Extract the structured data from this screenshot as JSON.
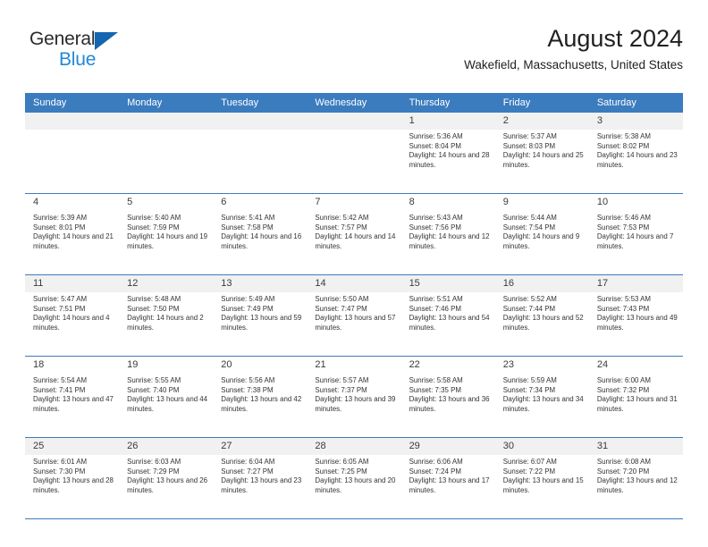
{
  "brand": {
    "line1": "General",
    "line2": "Blue",
    "mark": "triangle-icon",
    "color_dark": "#2b2b2b",
    "color_blue": "#2089d8",
    "mark_color": "#1565b0"
  },
  "header": {
    "title": "August 2024",
    "subtitle": "Wakefield, Massachusetts, United States"
  },
  "theme": {
    "header_bg": "#3b7cbe",
    "header_text": "#ffffff",
    "row_shade": "#f1f1f1",
    "grid_line": "#3b7cbe"
  },
  "labels": {
    "sunrise": "Sunrise:",
    "sunset": "Sunset:",
    "daylight": "Daylight:"
  },
  "weekday_headers": [
    "Sunday",
    "Monday",
    "Tuesday",
    "Wednesday",
    "Thursday",
    "Friday",
    "Saturday"
  ],
  "weeks": [
    [
      {
        "day": "",
        "lines": []
      },
      {
        "day": "",
        "lines": []
      },
      {
        "day": "",
        "lines": []
      },
      {
        "day": "",
        "lines": []
      },
      {
        "day": "1",
        "lines": [
          "Sunrise: 5:36 AM",
          "Sunset: 8:04 PM",
          "Daylight: 14 hours and 28 minutes."
        ]
      },
      {
        "day": "2",
        "lines": [
          "Sunrise: 5:37 AM",
          "Sunset: 8:03 PM",
          "Daylight: 14 hours and 25 minutes."
        ]
      },
      {
        "day": "3",
        "lines": [
          "Sunrise: 5:38 AM",
          "Sunset: 8:02 PM",
          "Daylight: 14 hours and 23 minutes."
        ]
      }
    ],
    [
      {
        "day": "4",
        "lines": [
          "Sunrise: 5:39 AM",
          "Sunset: 8:01 PM",
          "Daylight: 14 hours and 21 minutes."
        ]
      },
      {
        "day": "5",
        "lines": [
          "Sunrise: 5:40 AM",
          "Sunset: 7:59 PM",
          "Daylight: 14 hours and 19 minutes."
        ]
      },
      {
        "day": "6",
        "lines": [
          "Sunrise: 5:41 AM",
          "Sunset: 7:58 PM",
          "Daylight: 14 hours and 16 minutes."
        ]
      },
      {
        "day": "7",
        "lines": [
          "Sunrise: 5:42 AM",
          "Sunset: 7:57 PM",
          "Daylight: 14 hours and 14 minutes."
        ]
      },
      {
        "day": "8",
        "lines": [
          "Sunrise: 5:43 AM",
          "Sunset: 7:56 PM",
          "Daylight: 14 hours and 12 minutes."
        ]
      },
      {
        "day": "9",
        "lines": [
          "Sunrise: 5:44 AM",
          "Sunset: 7:54 PM",
          "Daylight: 14 hours and 9 minutes."
        ]
      },
      {
        "day": "10",
        "lines": [
          "Sunrise: 5:46 AM",
          "Sunset: 7:53 PM",
          "Daylight: 14 hours and 7 minutes."
        ]
      }
    ],
    [
      {
        "day": "11",
        "lines": [
          "Sunrise: 5:47 AM",
          "Sunset: 7:51 PM",
          "Daylight: 14 hours and 4 minutes."
        ]
      },
      {
        "day": "12",
        "lines": [
          "Sunrise: 5:48 AM",
          "Sunset: 7:50 PM",
          "Daylight: 14 hours and 2 minutes."
        ]
      },
      {
        "day": "13",
        "lines": [
          "Sunrise: 5:49 AM",
          "Sunset: 7:49 PM",
          "Daylight: 13 hours and 59 minutes."
        ]
      },
      {
        "day": "14",
        "lines": [
          "Sunrise: 5:50 AM",
          "Sunset: 7:47 PM",
          "Daylight: 13 hours and 57 minutes."
        ]
      },
      {
        "day": "15",
        "lines": [
          "Sunrise: 5:51 AM",
          "Sunset: 7:46 PM",
          "Daylight: 13 hours and 54 minutes."
        ]
      },
      {
        "day": "16",
        "lines": [
          "Sunrise: 5:52 AM",
          "Sunset: 7:44 PM",
          "Daylight: 13 hours and 52 minutes."
        ]
      },
      {
        "day": "17",
        "lines": [
          "Sunrise: 5:53 AM",
          "Sunset: 7:43 PM",
          "Daylight: 13 hours and 49 minutes."
        ]
      }
    ],
    [
      {
        "day": "18",
        "lines": [
          "Sunrise: 5:54 AM",
          "Sunset: 7:41 PM",
          "Daylight: 13 hours and 47 minutes."
        ]
      },
      {
        "day": "19",
        "lines": [
          "Sunrise: 5:55 AM",
          "Sunset: 7:40 PM",
          "Daylight: 13 hours and 44 minutes."
        ]
      },
      {
        "day": "20",
        "lines": [
          "Sunrise: 5:56 AM",
          "Sunset: 7:38 PM",
          "Daylight: 13 hours and 42 minutes."
        ]
      },
      {
        "day": "21",
        "lines": [
          "Sunrise: 5:57 AM",
          "Sunset: 7:37 PM",
          "Daylight: 13 hours and 39 minutes."
        ]
      },
      {
        "day": "22",
        "lines": [
          "Sunrise: 5:58 AM",
          "Sunset: 7:35 PM",
          "Daylight: 13 hours and 36 minutes."
        ]
      },
      {
        "day": "23",
        "lines": [
          "Sunrise: 5:59 AM",
          "Sunset: 7:34 PM",
          "Daylight: 13 hours and 34 minutes."
        ]
      },
      {
        "day": "24",
        "lines": [
          "Sunrise: 6:00 AM",
          "Sunset: 7:32 PM",
          "Daylight: 13 hours and 31 minutes."
        ]
      }
    ],
    [
      {
        "day": "25",
        "lines": [
          "Sunrise: 6:01 AM",
          "Sunset: 7:30 PM",
          "Daylight: 13 hours and 28 minutes."
        ]
      },
      {
        "day": "26",
        "lines": [
          "Sunrise: 6:03 AM",
          "Sunset: 7:29 PM",
          "Daylight: 13 hours and 26 minutes."
        ]
      },
      {
        "day": "27",
        "lines": [
          "Sunrise: 6:04 AM",
          "Sunset: 7:27 PM",
          "Daylight: 13 hours and 23 minutes."
        ]
      },
      {
        "day": "28",
        "lines": [
          "Sunrise: 6:05 AM",
          "Sunset: 7:25 PM",
          "Daylight: 13 hours and 20 minutes."
        ]
      },
      {
        "day": "29",
        "lines": [
          "Sunrise: 6:06 AM",
          "Sunset: 7:24 PM",
          "Daylight: 13 hours and 17 minutes."
        ]
      },
      {
        "day": "30",
        "lines": [
          "Sunrise: 6:07 AM",
          "Sunset: 7:22 PM",
          "Daylight: 13 hours and 15 minutes."
        ]
      },
      {
        "day": "31",
        "lines": [
          "Sunrise: 6:08 AM",
          "Sunset: 7:20 PM",
          "Daylight: 13 hours and 12 minutes."
        ]
      }
    ]
  ]
}
